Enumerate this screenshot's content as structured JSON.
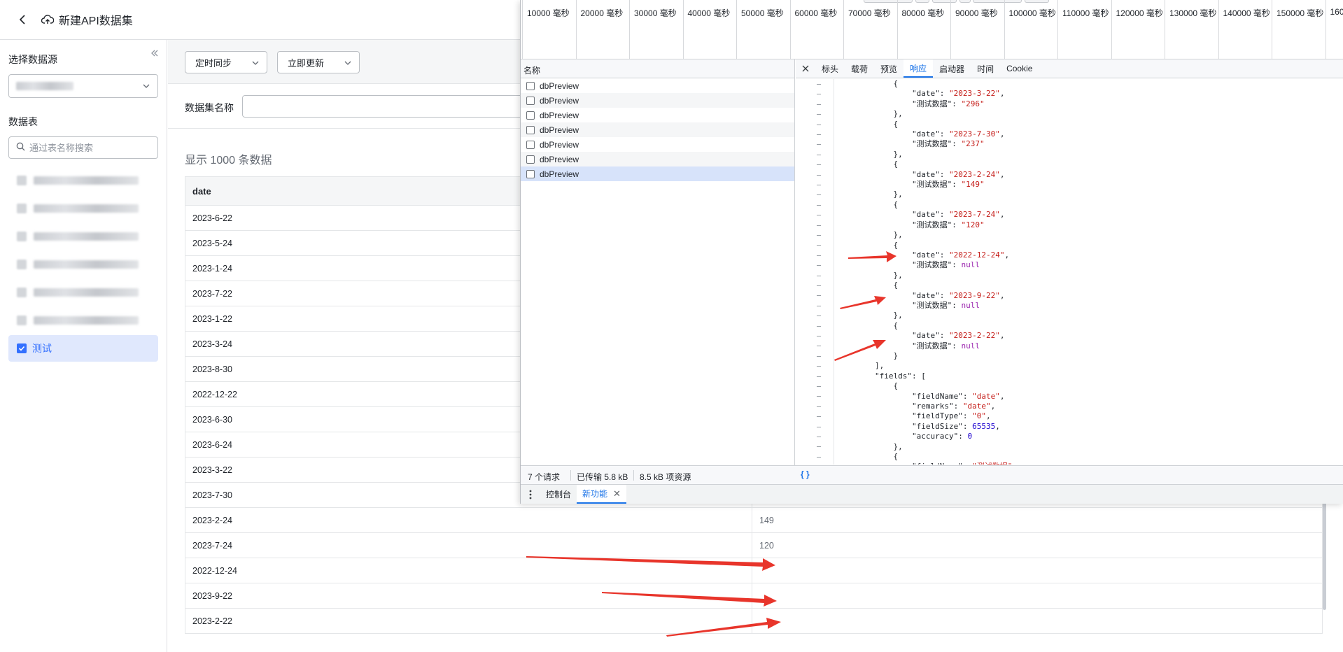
{
  "header": {
    "title": "新建API数据集"
  },
  "sidebar": {
    "source_label": "选择数据源",
    "table_label": "数据表",
    "search_placeholder": "通过表名称搜索",
    "active_table": "测试"
  },
  "toolbar": {
    "sync_label": "定时同步",
    "update_label": "立即更新"
  },
  "form": {
    "name_label": "数据集名称"
  },
  "preview": {
    "count_text": "显示 1000 条数据",
    "column": "date",
    "rows": [
      {
        "date": "2023-6-22",
        "value": ""
      },
      {
        "date": "2023-5-24",
        "value": ""
      },
      {
        "date": "2023-1-24",
        "value": ""
      },
      {
        "date": "2023-7-22",
        "value": ""
      },
      {
        "date": "2023-1-22",
        "value": ""
      },
      {
        "date": "2023-3-24",
        "value": ""
      },
      {
        "date": "2023-8-30",
        "value": ""
      },
      {
        "date": "2022-12-22",
        "value": ""
      },
      {
        "date": "2023-6-30",
        "value": ""
      },
      {
        "date": "2023-6-24",
        "value": ""
      },
      {
        "date": "2023-3-22",
        "value": ""
      },
      {
        "date": "2023-7-30",
        "value": ""
      },
      {
        "date": "2023-2-24",
        "value": "149"
      },
      {
        "date": "2023-7-24",
        "value": "120"
      },
      {
        "date": "2022-12-24",
        "value": ""
      },
      {
        "date": "2023-9-22",
        "value": ""
      },
      {
        "date": "2023-2-22",
        "value": ""
      }
    ]
  },
  "devtools": {
    "timeline_ticks": [
      "10000 毫秒",
      "20000 毫秒",
      "30000 毫秒",
      "40000 毫秒",
      "50000 毫秒",
      "60000 毫秒",
      "70000 毫秒",
      "80000 毫秒",
      "90000 毫秒",
      "100000 毫秒",
      "110000 毫秒",
      "120000 毫秒",
      "130000 毫秒",
      "140000 毫秒",
      "150000 毫秒",
      "160"
    ],
    "name_header": "名称",
    "requests": [
      "dbPreview",
      "dbPreview",
      "dbPreview",
      "dbPreview",
      "dbPreview",
      "dbPreview",
      "dbPreview"
    ],
    "tabs": [
      "标头",
      "载荷",
      "预览",
      "响应",
      "启动器",
      "时间",
      "Cookie"
    ],
    "active_tab": "响应",
    "footer": {
      "requests": "7 个请求",
      "transferred": "已传输 5.8 kB",
      "resources": "8.5 kB 项资源",
      "format": "{ }"
    },
    "drawer": {
      "console": "控制台",
      "whats_new": "新功能"
    },
    "json_lines": [
      {
        "t": "            {"
      },
      {
        "t": "                ",
        "key": "\"date\"",
        "val": "\"2023-3-22\"",
        "vt": "s",
        "end": ","
      },
      {
        "t": "                ",
        "key": "\"测试数据\"",
        "val": "\"296\"",
        "vt": "s",
        "end": ""
      },
      {
        "t": "            },"
      },
      {
        "t": "            {"
      },
      {
        "t": "                ",
        "key": "\"date\"",
        "val": "\"2023-7-30\"",
        "vt": "s",
        "end": ","
      },
      {
        "t": "                ",
        "key": "\"测试数据\"",
        "val": "\"237\"",
        "vt": "s",
        "end": ""
      },
      {
        "t": "            },"
      },
      {
        "t": "            {"
      },
      {
        "t": "                ",
        "key": "\"date\"",
        "val": "\"2023-2-24\"",
        "vt": "s",
        "end": ","
      },
      {
        "t": "                ",
        "key": "\"测试数据\"",
        "val": "\"149\"",
        "vt": "s",
        "end": ""
      },
      {
        "t": "            },"
      },
      {
        "t": "            {"
      },
      {
        "t": "                ",
        "key": "\"date\"",
        "val": "\"2023-7-24\"",
        "vt": "s",
        "end": ","
      },
      {
        "t": "                ",
        "key": "\"测试数据\"",
        "val": "\"120\"",
        "vt": "s",
        "end": ""
      },
      {
        "t": "            },"
      },
      {
        "t": "            {"
      },
      {
        "t": "                ",
        "key": "\"date\"",
        "val": "\"2022-12-24\"",
        "vt": "s",
        "end": ","
      },
      {
        "t": "                ",
        "key": "\"测试数据\"",
        "val": "null",
        "vt": "nl",
        "end": ""
      },
      {
        "t": "            },"
      },
      {
        "t": "            {"
      },
      {
        "t": "                ",
        "key": "\"date\"",
        "val": "\"2023-9-22\"",
        "vt": "s",
        "end": ","
      },
      {
        "t": "                ",
        "key": "\"测试数据\"",
        "val": "null",
        "vt": "nl",
        "end": ""
      },
      {
        "t": "            },"
      },
      {
        "t": "            {"
      },
      {
        "t": "                ",
        "key": "\"date\"",
        "val": "\"2023-2-22\"",
        "vt": "s",
        "end": ","
      },
      {
        "t": "                ",
        "key": "\"测试数据\"",
        "val": "null",
        "vt": "nl",
        "end": ""
      },
      {
        "t": "            }"
      },
      {
        "t": "        ],"
      },
      {
        "t": "        ",
        "key": "\"fields\"",
        "val": "",
        "vt": "k",
        "end": "["
      },
      {
        "t": "            {"
      },
      {
        "t": "                ",
        "key": "\"fieldName\"",
        "val": "\"date\"",
        "vt": "s",
        "end": ","
      },
      {
        "t": "                ",
        "key": "\"remarks\"",
        "val": "\"date\"",
        "vt": "s",
        "end": ","
      },
      {
        "t": "                ",
        "key": "\"fieldType\"",
        "val": "\"0\"",
        "vt": "s",
        "end": ","
      },
      {
        "t": "                ",
        "key": "\"fieldSize\"",
        "val": "65535",
        "vt": "n",
        "end": ","
      },
      {
        "t": "                ",
        "key": "\"accuracy\"",
        "val": "0",
        "vt": "n",
        "end": ""
      },
      {
        "t": "            },"
      },
      {
        "t": "            {"
      },
      {
        "t": "                ",
        "key": "\"fieldName\"",
        "val": "\"测试数据\"",
        "vt": "s",
        "end": ","
      }
    ]
  },
  "colors": {
    "accent": "#3370ff",
    "devtools_accent": "#1a73e8",
    "annotation": "#e8352b"
  }
}
